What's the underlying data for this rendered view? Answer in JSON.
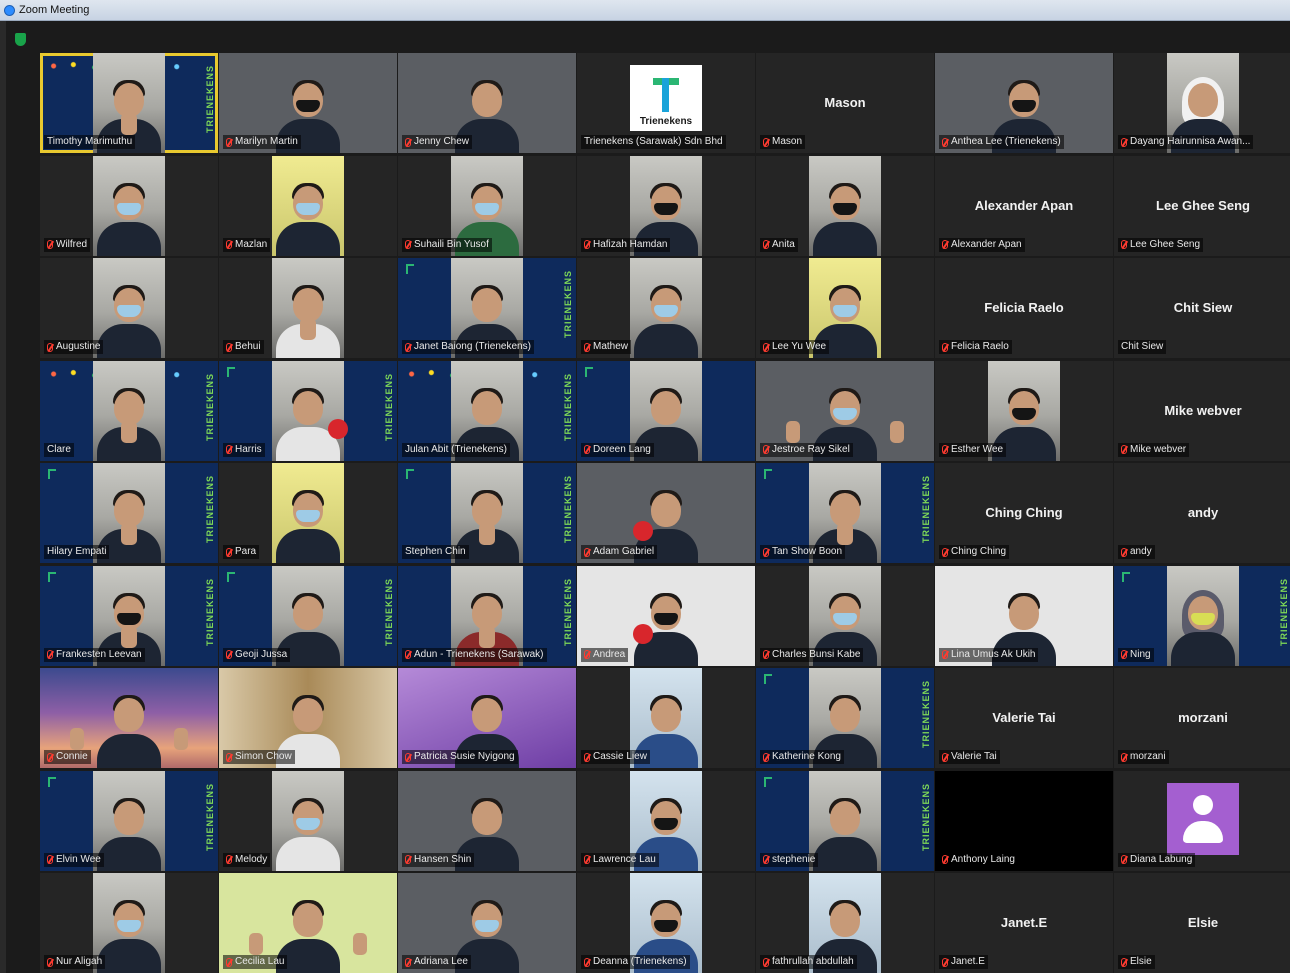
{
  "window": {
    "title": "Zoom Meeting"
  },
  "brand_text": "TRIENEKENS",
  "logo_card_text": "Trienekens",
  "colors": {
    "active_speaker": "#e8c92f",
    "muted_mic": "#ff3b30",
    "brand_green": "#7ed957"
  },
  "tiles": [
    {
      "label": "Timothy Marimuthu",
      "bg": "bg-navy",
      "kind": "person",
      "active": true,
      "muted": false,
      "brand": true,
      "confetti": true,
      "thumbs": true
    },
    {
      "label": "Marilyn Martin",
      "bg": "bg-photo",
      "kind": "person-wide",
      "muted": true,
      "mask": "black"
    },
    {
      "label": "Jenny Chew",
      "bg": "bg-photo",
      "kind": "person-wide",
      "muted": true
    },
    {
      "label": "Trienekens (Sarawak) Sdn Bhd",
      "bg": "bg-dark",
      "kind": "logo",
      "muted": false
    },
    {
      "label": "Mason",
      "bg": "bg-dark",
      "kind": "name",
      "center": "Mason",
      "muted": true
    },
    {
      "label": "Anthea Lee (Trienekens)",
      "bg": "bg-photo",
      "kind": "person-wide",
      "muted": true,
      "mask": "black"
    },
    {
      "label": "Dayang Hairunnisa Awan...",
      "bg": "bg-dark",
      "kind": "person",
      "muted": true,
      "hijab": "white"
    },
    {
      "label": "Wilfred",
      "bg": "bg-dark",
      "kind": "person",
      "muted": true,
      "mask": "lblue"
    },
    {
      "label": "Mazlan",
      "bg": "bg-dark",
      "kind": "person",
      "muted": true,
      "video": "yellow",
      "mask": "lblue"
    },
    {
      "label": "Suhaili Bin Yusof",
      "bg": "bg-dark",
      "kind": "person",
      "muted": true,
      "mask": "lblue",
      "body": "green"
    },
    {
      "label": "Hafizah Hamdan",
      "bg": "bg-dark",
      "kind": "person",
      "muted": true,
      "mask": "black"
    },
    {
      "label": "Anita",
      "bg": "bg-dark",
      "kind": "person",
      "muted": true,
      "mask": "black"
    },
    {
      "label": "Alexander Apan",
      "bg": "bg-dark",
      "kind": "name",
      "center": "Alexander Apan",
      "muted": true
    },
    {
      "label": "Lee Ghee Seng",
      "bg": "bg-dark",
      "kind": "name",
      "center": "Lee Ghee Seng",
      "muted": true
    },
    {
      "label": "Augustine",
      "bg": "bg-dark",
      "kind": "person",
      "muted": true,
      "mask": "lblue"
    },
    {
      "label": "Behui",
      "bg": "bg-dark",
      "kind": "person",
      "muted": true,
      "body": "light",
      "thumbs": true
    },
    {
      "label": "Janet Baiong (Trienekens)",
      "bg": "bg-navy",
      "kind": "person",
      "muted": true,
      "brand": true,
      "logo_mini": true
    },
    {
      "label": "Mathew",
      "bg": "bg-dark",
      "kind": "person",
      "muted": true,
      "mask": "lblue"
    },
    {
      "label": "Lee Yu Wee",
      "bg": "bg-dark",
      "kind": "person",
      "muted": true,
      "video": "yellow",
      "mask": "lblue"
    },
    {
      "label": "Felicia Raelo",
      "bg": "bg-dark",
      "kind": "name",
      "center": "Felicia Raelo",
      "muted": true
    },
    {
      "label": "Chit Siew",
      "bg": "bg-dark",
      "kind": "name",
      "center": "Chit Siew",
      "muted": false
    },
    {
      "label": "Clare",
      "bg": "bg-navy",
      "kind": "person",
      "muted": false,
      "brand": true,
      "confetti": true,
      "thumbs": true
    },
    {
      "label": "Harris",
      "bg": "bg-navy",
      "kind": "person",
      "muted": true,
      "brand": true,
      "logo_mini": true,
      "body": "light",
      "redball": true
    },
    {
      "label": "Julan Abit (Trienekens)",
      "bg": "bg-navy",
      "kind": "person",
      "muted": false,
      "brand": true,
      "confetti": true
    },
    {
      "label": "Doreen Lang",
      "bg": "bg-navy",
      "kind": "person",
      "muted": true,
      "logo_mini": true
    },
    {
      "label": "Jestroe Ray Sikel",
      "bg": "bg-photo",
      "kind": "person-wide",
      "muted": true,
      "mask": "lblue",
      "thumbs": true
    },
    {
      "label": "Esther Wee",
      "bg": "bg-dark",
      "kind": "person",
      "muted": true,
      "mask": "black"
    },
    {
      "label": "Mike webver",
      "bg": "bg-dark",
      "kind": "name",
      "center": "Mike webver",
      "muted": true
    },
    {
      "label": "Hilary Empati",
      "bg": "bg-navy",
      "kind": "person",
      "muted": false,
      "brand": true,
      "logo_mini": true,
      "thumbs": true
    },
    {
      "label": "Para",
      "bg": "bg-dark",
      "kind": "person",
      "muted": true,
      "video": "yellow",
      "mask": "lblue"
    },
    {
      "label": "Stephen Chin",
      "bg": "bg-navy",
      "kind": "person",
      "muted": false,
      "brand": true,
      "logo_mini": true,
      "thumbs": true
    },
    {
      "label": "Adam Gabriel",
      "bg": "bg-photo",
      "kind": "person-wide",
      "muted": true,
      "redball": true
    },
    {
      "label": "Tan Show Boon",
      "bg": "bg-navy",
      "kind": "person",
      "muted": true,
      "brand": true,
      "logo_mini": true,
      "thumbs": true
    },
    {
      "label": "Ching Ching",
      "bg": "bg-dark",
      "kind": "name",
      "center": "Ching Ching",
      "muted": true
    },
    {
      "label": "andy",
      "bg": "bg-dark",
      "kind": "name",
      "center": "andy",
      "muted": true
    },
    {
      "label": "Frankesten Leevan",
      "bg": "bg-navy",
      "kind": "person",
      "muted": true,
      "brand": true,
      "logo_mini": true,
      "mask": "black",
      "thumbs": true
    },
    {
      "label": "Geoji Jussa",
      "bg": "bg-navy",
      "kind": "person",
      "muted": true,
      "brand": true,
      "logo_mini": true
    },
    {
      "label": "Adun - Trienekens (Sarawak)",
      "bg": "bg-navy",
      "kind": "person",
      "muted": true,
      "brand": true,
      "thumbs": true,
      "body": "red"
    },
    {
      "label": "Andrea",
      "bg": "bg-white",
      "kind": "person-wide",
      "muted": true,
      "mask": "black",
      "redball": true
    },
    {
      "label": "Charles Bunsi Kabe",
      "bg": "bg-dark",
      "kind": "person",
      "muted": true,
      "mask": "lblue"
    },
    {
      "label": "Lina Umus Ak Ukih",
      "bg": "bg-white",
      "kind": "person-wide",
      "muted": true
    },
    {
      "label": "Ning",
      "bg": "bg-navy",
      "kind": "person",
      "muted": true,
      "brand": true,
      "logo_mini": true,
      "hijab": "dark",
      "mask": "yellow"
    },
    {
      "label": "Connie",
      "bg": "bg-sunset",
      "kind": "person-wide",
      "muted": true,
      "thumbs": true
    },
    {
      "label": "Simon Chow",
      "bg": "bg-shelf",
      "kind": "person-wide",
      "muted": true,
      "body": "light"
    },
    {
      "label": "Patricia Susie Nyigong",
      "bg": "bg-pink",
      "kind": "person-wide",
      "muted": true
    },
    {
      "label": "Cassie Liew",
      "bg": "bg-dark",
      "kind": "person",
      "muted": true,
      "video": "lightblue",
      "body": "blue"
    },
    {
      "label": "Katherine Kong",
      "bg": "bg-navy",
      "kind": "person",
      "muted": true,
      "brand": true,
      "logo_mini": true
    },
    {
      "label": "Valerie Tai",
      "bg": "bg-dark",
      "kind": "name",
      "center": "Valerie Tai",
      "muted": true
    },
    {
      "label": "morzani",
      "bg": "bg-dark",
      "kind": "name",
      "center": "morzani",
      "muted": true
    },
    {
      "label": "Elvin Wee",
      "bg": "bg-navy",
      "kind": "person",
      "muted": true,
      "brand": true,
      "logo_mini": true
    },
    {
      "label": "Melody",
      "bg": "bg-dark",
      "kind": "person",
      "muted": true,
      "mask": "lblue",
      "body": "light"
    },
    {
      "label": "Hansen Shin",
      "bg": "bg-photo",
      "kind": "person-wide",
      "muted": true
    },
    {
      "label": "Lawrence Lau",
      "bg": "bg-dark",
      "kind": "person",
      "muted": true,
      "video": "lightblue",
      "mask": "black",
      "body": "blue"
    },
    {
      "label": "stephenie",
      "bg": "bg-navy",
      "kind": "person",
      "muted": true,
      "brand": true,
      "logo_mini": true
    },
    {
      "label": "Anthony Laing",
      "bg": "bg-black",
      "kind": "empty",
      "muted": true
    },
    {
      "label": "Diana Labung",
      "bg": "bg-dark",
      "kind": "avatar",
      "muted": true
    },
    {
      "label": "Nur Aligah",
      "bg": "bg-dark",
      "kind": "person",
      "muted": true,
      "mask": "lblue"
    },
    {
      "label": "Cecilia Lau",
      "bg": "bg-lime",
      "kind": "person-wide",
      "muted": true,
      "thumbs": true
    },
    {
      "label": "Adriana Lee",
      "bg": "bg-photo",
      "kind": "person-wide",
      "muted": true,
      "mask": "lblue"
    },
    {
      "label": "Deanna (Trienekens)",
      "bg": "bg-dark",
      "kind": "person",
      "muted": true,
      "video": "lightblue",
      "mask": "black",
      "body": "blue"
    },
    {
      "label": "fathrullah abdullah",
      "bg": "bg-dark",
      "kind": "person",
      "muted": true,
      "video": "lightblue"
    },
    {
      "label": "Janet.E",
      "bg": "bg-dark",
      "kind": "name",
      "center": "Janet.E",
      "muted": true
    },
    {
      "label": "Elsie",
      "bg": "bg-dark",
      "kind": "name",
      "center": "Elsie",
      "muted": true
    }
  ]
}
